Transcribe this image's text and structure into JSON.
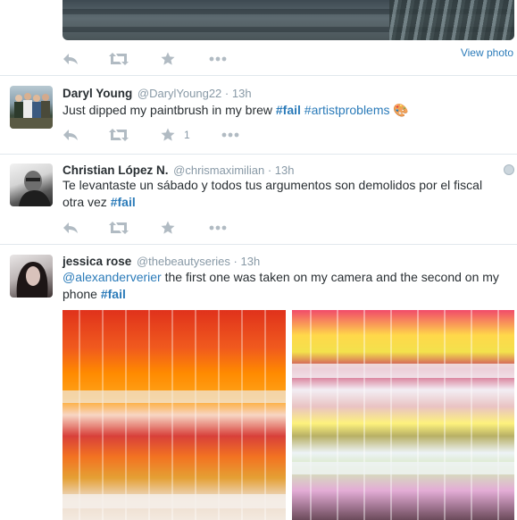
{
  "top_tweet": {
    "view_photo_label": "View photo"
  },
  "tweets": [
    {
      "name": "Daryl Young",
      "handle": "@DarylYoung22",
      "separator": "·",
      "time": "13h",
      "text_plain": "Just dipped my paintbrush in my brew ",
      "hashtags": [
        "#fail",
        "#artistproblems"
      ],
      "emoji": "🎨",
      "favorite_count": "1"
    },
    {
      "name": "Christian López N.",
      "handle": "@chrismaximilian",
      "separator": "·",
      "time": "13h",
      "text_plain": "Te levantaste un sábado y todos tus argumentos son demolidos por el fiscal otra vez ",
      "hashtags": [
        "#fail"
      ]
    },
    {
      "name": "jessica rose",
      "handle": "@thebeautyseries",
      "separator": "·",
      "time": "13h",
      "mention": "@alexanderverier",
      "text_plain": " the first one was taken on my camera and the second on my phone ",
      "hashtags": [
        "#fail"
      ]
    }
  ],
  "icons": {
    "reply": "reply-icon",
    "retweet": "retweet-icon",
    "favorite": "star-icon",
    "more": "more-icon",
    "globe": "globe-icon"
  },
  "colors": {
    "link": "#2b7bb9",
    "muted": "#8899a6",
    "icon": "#b1bbc3",
    "divider": "#e1e8ed"
  }
}
